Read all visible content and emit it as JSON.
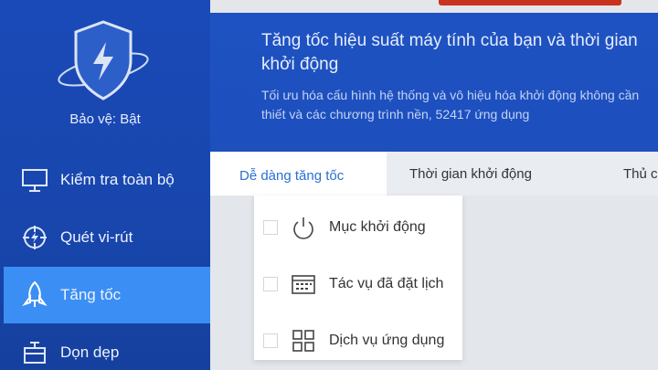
{
  "sidebar": {
    "protection_status": "Bảo vệ: Bật",
    "items": [
      {
        "label": "Kiểm tra toàn bộ",
        "icon": "monitor-icon"
      },
      {
        "label": "Quét vi-rút",
        "icon": "scan-target-icon"
      },
      {
        "label": "Tăng tốc",
        "icon": "rocket-icon"
      },
      {
        "label": "Dọn dẹp",
        "icon": "cleanup-icon"
      }
    ],
    "active_item": "Tăng tốc"
  },
  "banner": {
    "title": "Tăng tốc hiệu suất máy tính của bạn và thời gian khởi động",
    "description": "Tối ưu hóa cấu hình hệ thống và vô hiệu hóa khởi động không cần thiết và các chương trình nền, 52417 ứng dụng"
  },
  "tabs": [
    {
      "label": "Dễ dàng tăng tốc"
    },
    {
      "label": "Thời gian khởi động"
    },
    {
      "label": "Thủ c"
    }
  ],
  "dropdown": {
    "items": [
      {
        "label": "Mục khởi động",
        "icon": "power-icon",
        "checked": false
      },
      {
        "label": "Tác vụ đã đặt lịch",
        "icon": "calendar-icon",
        "checked": false
      },
      {
        "label": "Dịch vụ ứng dụng",
        "icon": "apps-grid-icon",
        "checked": false
      }
    ]
  },
  "colors": {
    "sidebar": "#1a4ab8",
    "active_item": "#3b8ef3",
    "banner": "#1e52c2",
    "accent_text": "#2a6fd6"
  }
}
